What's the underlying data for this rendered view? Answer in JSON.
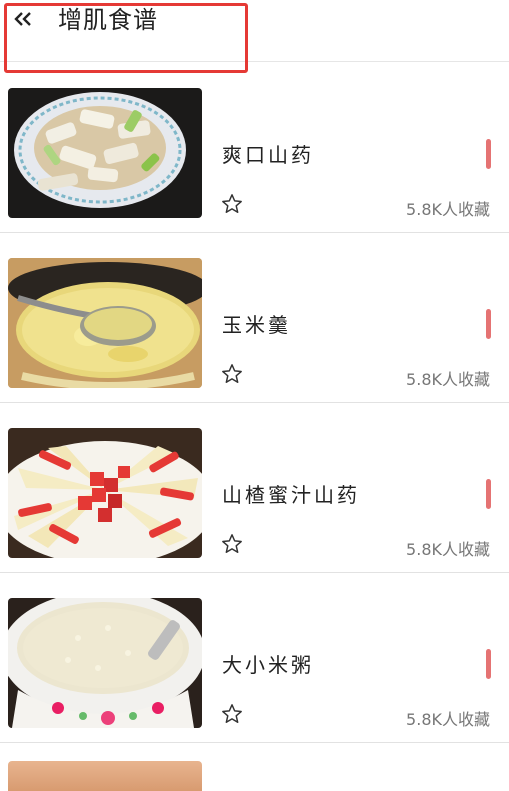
{
  "header": {
    "back_icon": "double-chevron-left-icon",
    "title": "增肌食谱",
    "highlight_color": "#e53935"
  },
  "recipes": [
    {
      "name": "爽口山药",
      "favorites": "5.8K人收藏",
      "image": "stir-fried-yam-with-scallion",
      "star_icon": "star-outline-icon"
    },
    {
      "name": "玉米羹",
      "favorites": "5.8K人收藏",
      "image": "corn-soup-with-spoon",
      "star_icon": "star-outline-icon"
    },
    {
      "name": "山楂蜜汁山药",
      "favorites": "5.8K人收藏",
      "image": "honey-yam-with-hawthorn",
      "star_icon": "star-outline-icon"
    },
    {
      "name": "大小米粥",
      "favorites": "5.8K人收藏",
      "image": "millet-rice-porridge",
      "star_icon": "star-outline-icon"
    }
  ],
  "accent_color": "#e57373"
}
